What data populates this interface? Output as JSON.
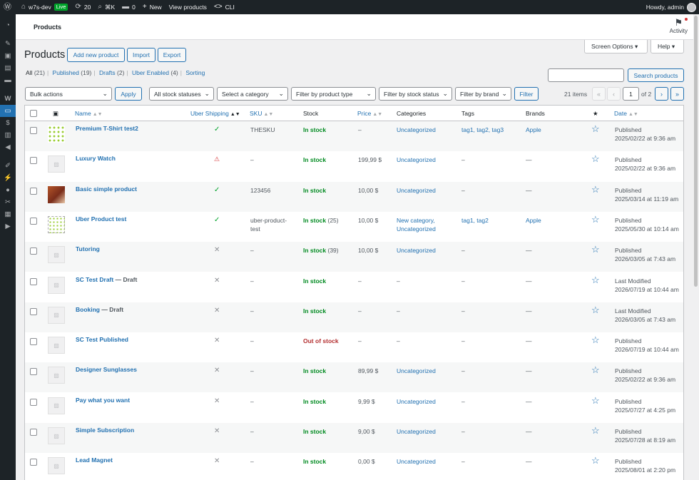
{
  "admin_bar": {
    "site_name": "w7s-dev",
    "live_badge": "Live",
    "updates_count": "20",
    "command_shortcut": "⌘K",
    "comments_count": "0",
    "new_label": "New",
    "view_products": "View products",
    "cli": "CLI",
    "greeting": "Howdy, admin"
  },
  "header": {
    "breadcrumb": "Products",
    "activity": "Activity"
  },
  "screen_options": "Screen Options",
  "help": "Help",
  "page": {
    "title": "Products",
    "add_new": "Add new product",
    "import": "Import",
    "export": "Export"
  },
  "views": [
    {
      "label": "All",
      "count": "(21)"
    },
    {
      "label": "Published",
      "count": "(19)"
    },
    {
      "label": "Drafts",
      "count": "(2)"
    },
    {
      "label": "Uber Enabled",
      "count": "(4)"
    },
    {
      "label": "Sorting",
      "count": ""
    }
  ],
  "search": {
    "button": "Search products",
    "value": ""
  },
  "filters": {
    "bulk_actions": "Bulk actions",
    "apply": "Apply",
    "stock_statuses": "All stock statuses",
    "category": "Select a category",
    "product_type": "Filter by product type",
    "stock_status": "Filter by stock status",
    "brand": "Filter by brand",
    "filter": "Filter"
  },
  "pagination": {
    "items": "21 items",
    "current_page": "1",
    "of": "of 2",
    "first": "«",
    "prev": "‹",
    "next": "›",
    "last": "»"
  },
  "columns": {
    "name": "Name",
    "uber_shipping": "Uber Shipping",
    "sku": "SKU",
    "stock": "Stock",
    "price": "Price",
    "categories": "Categories",
    "tags": "Tags",
    "brands": "Brands",
    "date": "Date"
  },
  "rows": [
    {
      "name": "Premium T-Shirt test2",
      "state": "",
      "thumb": "tshirt",
      "ship": "ok",
      "sku": "THESKU",
      "sku2": "",
      "stock": "In stock",
      "stock_qty": "",
      "stock_type": "in",
      "price": "–",
      "cat": "Uncategorized",
      "cat2": "",
      "tags": "tag1, tag2, tag3",
      "brand": "Apple",
      "date_status": "Published",
      "date": "2025/02/22 at 9:36 am"
    },
    {
      "name": "Luxury Watch",
      "state": "",
      "thumb": "ph",
      "ship": "warn",
      "sku": "–",
      "sku2": "",
      "stock": "In stock",
      "stock_qty": "",
      "stock_type": "in",
      "price": "199,99 $",
      "cat": "Uncategorized",
      "cat2": "",
      "tags": "–",
      "brand": "—",
      "date_status": "Published",
      "date": "2025/02/22 at 9:36 am"
    },
    {
      "name": "Basic simple product",
      "state": "",
      "thumb": "photo",
      "ship": "ok",
      "sku": "123456",
      "sku2": "",
      "stock": "In stock",
      "stock_qty": "",
      "stock_type": "in",
      "price": "10,00 $",
      "cat": "Uncategorized",
      "cat2": "",
      "tags": "–",
      "brand": "—",
      "date_status": "Published",
      "date": "2025/03/14 at 11:19 am"
    },
    {
      "name": "Uber Product test",
      "state": "",
      "thumb": "uber",
      "ship": "ok",
      "sku": "uber-product-",
      "sku2": "test",
      "stock": "In stock",
      "stock_qty": "(25)",
      "stock_type": "in",
      "price": "10,00 $",
      "cat": "New category,",
      "cat2": "Uncategorized",
      "tags": "tag1, tag2",
      "brand": "Apple",
      "date_status": "Published",
      "date": "2025/05/30 at 10:14 am"
    },
    {
      "name": "Tutoring",
      "state": "",
      "thumb": "ph",
      "ship": "no",
      "sku": "–",
      "sku2": "",
      "stock": "In stock",
      "stock_qty": "(39)",
      "stock_type": "in",
      "price": "10,00 $",
      "cat": "Uncategorized",
      "cat2": "",
      "tags": "–",
      "brand": "—",
      "date_status": "Published",
      "date": "2026/03/05 at 7:43 am"
    },
    {
      "name": "SC Test Draft",
      "state": "— Draft",
      "thumb": "ph",
      "ship": "no",
      "sku": "–",
      "sku2": "",
      "stock": "In stock",
      "stock_qty": "",
      "stock_type": "in",
      "price": "–",
      "cat": "–",
      "cat2": "",
      "tags": "–",
      "brand": "—",
      "date_status": "Last Modified",
      "date": "2026/07/19 at 10:44 am"
    },
    {
      "name": "Booking",
      "state": "— Draft",
      "thumb": "ph",
      "ship": "no",
      "sku": "–",
      "sku2": "",
      "stock": "In stock",
      "stock_qty": "",
      "stock_type": "in",
      "price": "–",
      "cat": "–",
      "cat2": "",
      "tags": "–",
      "brand": "—",
      "date_status": "Last Modified",
      "date": "2026/03/05 at 7:43 am"
    },
    {
      "name": "SC Test Published",
      "state": "",
      "thumb": "ph",
      "ship": "no",
      "sku": "–",
      "sku2": "",
      "stock": "Out of stock",
      "stock_qty": "",
      "stock_type": "out",
      "price": "–",
      "cat": "–",
      "cat2": "",
      "tags": "–",
      "brand": "—",
      "date_status": "Published",
      "date": "2026/07/19 at 10:44 am"
    },
    {
      "name": "Designer Sunglasses",
      "state": "",
      "thumb": "ph",
      "ship": "no",
      "sku": "–",
      "sku2": "",
      "stock": "In stock",
      "stock_qty": "",
      "stock_type": "in",
      "price": "89,99 $",
      "cat": "Uncategorized",
      "cat2": "",
      "tags": "–",
      "brand": "—",
      "date_status": "Published",
      "date": "2025/02/22 at 9:36 am"
    },
    {
      "name": "Pay what you want",
      "state": "",
      "thumb": "ph",
      "ship": "no",
      "sku": "–",
      "sku2": "",
      "stock": "In stock",
      "stock_qty": "",
      "stock_type": "in",
      "price": "9,99 $",
      "cat": "Uncategorized",
      "cat2": "",
      "tags": "–",
      "brand": "—",
      "date_status": "Published",
      "date": "2025/07/27 at 4:25 pm"
    },
    {
      "name": "Simple Subscription",
      "state": "",
      "thumb": "ph",
      "ship": "no",
      "sku": "–",
      "sku2": "",
      "stock": "In stock",
      "stock_qty": "",
      "stock_type": "in",
      "price": "9,00 $",
      "cat": "Uncategorized",
      "cat2": "",
      "tags": "–",
      "brand": "—",
      "date_status": "Published",
      "date": "2025/07/28 at 8:19 am"
    },
    {
      "name": "Lead Magnet",
      "state": "",
      "thumb": "ph",
      "ship": "no",
      "sku": "–",
      "sku2": "",
      "stock": "In stock",
      "stock_qty": "",
      "stock_type": "in",
      "price": "0,00 $",
      "cat": "Uncategorized",
      "cat2": "",
      "tags": "–",
      "brand": "—",
      "date_status": "Published",
      "date": "2025/08/01 at 2:20 pm"
    }
  ],
  "icons": {
    "ok": "✓",
    "warn": "⚠",
    "no": "✕",
    "star": "☆",
    "image_placeholder": "▨"
  },
  "colors": {
    "accent": "#2271b1",
    "in_stock": "#008a20",
    "out_of_stock": "#b32d2e",
    "admin_bar": "#1d2327"
  }
}
